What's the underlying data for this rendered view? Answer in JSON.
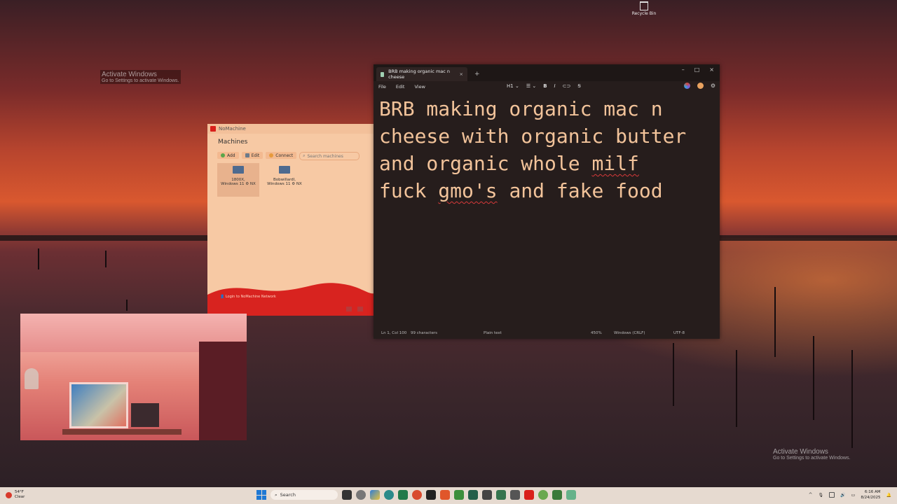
{
  "desktop": {
    "recycle_bin_label": "Recycle Bin",
    "watermark_top": {
      "title": "Activate Windows",
      "subtitle": "Go to Settings to activate Windows."
    },
    "watermark_bottom": {
      "title": "Activate Windows",
      "subtitle": "Go to Settings to activate Windows."
    }
  },
  "nomachine": {
    "app_title": "NoMachine",
    "heading": "Machines",
    "toolbar": {
      "add": "Add",
      "edit": "Edit",
      "connect": "Connect",
      "search_placeholder": "Search machines"
    },
    "machines": [
      {
        "name": "1800X,",
        "os": "Windows 11",
        "protocol": "NX"
      },
      {
        "name": "BobwillardI,",
        "os": "Windows 11",
        "protocol": "NX"
      }
    ],
    "footer_text": "Login to NoMachine Network"
  },
  "notepad": {
    "tab_title": "BRB making organic mac n cheese",
    "menu": {
      "file": "File",
      "edit": "Edit",
      "view": "View"
    },
    "format": {
      "heading": "H1",
      "bold": "B",
      "italic": "I"
    },
    "content": {
      "line1": "BRB making organic mac n",
      "line2": "cheese with organic butter",
      "line3a": "and organic whole ",
      "line3b": "milf",
      "line4a": "fuck ",
      "line4b": "gmo's",
      "line4c": " and fake food"
    },
    "status": {
      "position": "Ln 1, Col 100",
      "characters": "99 characters",
      "mode": "Plain text",
      "zoom": "450%",
      "line_ending": "Windows (CRLF)",
      "encoding": "UTF-8"
    }
  },
  "taskbar": {
    "weather_temp": "54°F",
    "weather_desc": "Clear",
    "search_label": "Search",
    "time": "6:16 AM",
    "date": "8/24/2025"
  }
}
